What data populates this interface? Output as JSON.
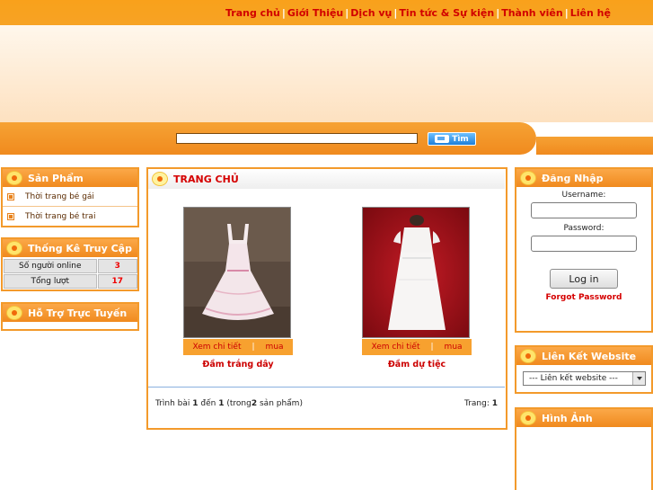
{
  "nav": {
    "items": [
      "Trang chủ",
      "Giới Thiệu",
      "Dịch vụ",
      "Tin tức & Sự kiện",
      "Thành viên",
      "Liên hệ"
    ],
    "separator": "|"
  },
  "search": {
    "value": "",
    "button_label": "Tìm"
  },
  "sidebar": {
    "products": {
      "title": "Sản Phẩm",
      "items": [
        "Thời trang bé gái",
        "Thời trang bé trai"
      ]
    },
    "stats": {
      "title": "Thống Kê Truy Cập",
      "rows": [
        {
          "label": "Số người online",
          "value": "3"
        },
        {
          "label": "Tổng lượt",
          "value": "17"
        }
      ]
    },
    "support": {
      "title": "Hỗ Trợ Trực Tuyến"
    }
  },
  "main": {
    "title": "TRANG CHỦ",
    "products": [
      {
        "name": "Đầm trắng dây",
        "detail_label": "Xem chi tiết",
        "buy_label": "mua"
      },
      {
        "name": "Đầm dự tiệc",
        "detail_label": "Xem chi tiết",
        "buy_label": "mua"
      }
    ],
    "pager": {
      "prefix": "Trình bài",
      "from": "1",
      "to_word": "đến",
      "to": "1",
      "total_open": "(trong",
      "total": "2",
      "total_close": "sản phẩm)",
      "page_label": "Trang:",
      "page": "1"
    }
  },
  "right": {
    "login": {
      "title": "Đăng Nhập",
      "username_label": "Username:",
      "password_label": "Password:",
      "login_button": "Log in",
      "forgot_label": "Forgot Password"
    },
    "links": {
      "title": "Liên Kết Website",
      "select_value": "--- Liên kết website ---"
    },
    "images": {
      "title": "Hình Ảnh"
    }
  },
  "colors": {
    "orange": "#f39a2b",
    "red_text": "#d50000"
  }
}
